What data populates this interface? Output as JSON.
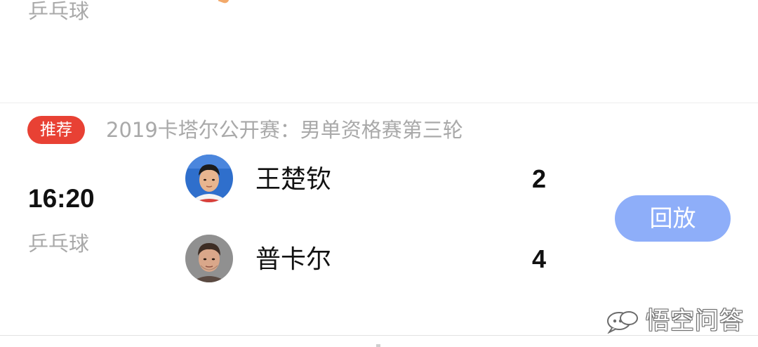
{
  "previous_item": {
    "sport": "乒乓球"
  },
  "match": {
    "badge": "推荐",
    "title": "2019卡塔尔公开赛：男单资格赛第三轮",
    "time": "16:20",
    "sport": "乒乓球",
    "players": [
      {
        "name": "王楚钦",
        "score": "2",
        "avatar_icon": "player-avatar-icon"
      },
      {
        "name": "普卡尔",
        "score": "4",
        "avatar_icon": "player-avatar-icon"
      }
    ],
    "action_label": "回放"
  },
  "watermark": {
    "text": "悟空问答",
    "icon": "wukong-logo-icon"
  },
  "colors": {
    "badge_red": "#e84134",
    "button_blue": "#8eaef9",
    "muted_text": "#a9a9a9",
    "primary_text": "#111111",
    "divider": "#ededed"
  }
}
